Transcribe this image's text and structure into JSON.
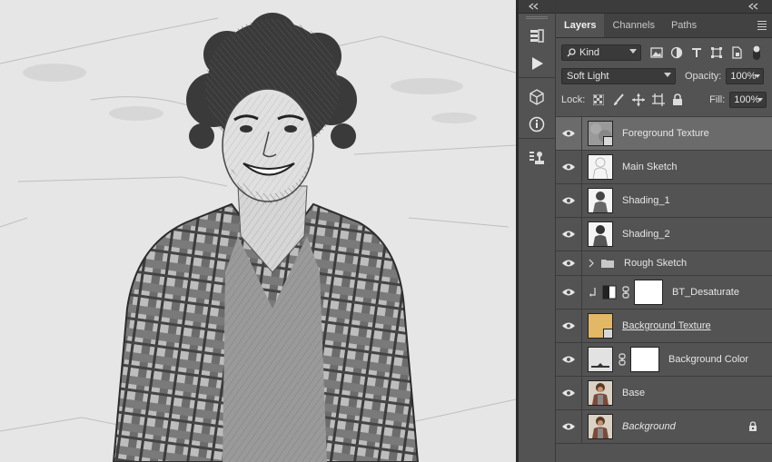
{
  "panel": {
    "tabs": [
      {
        "label": "Layers",
        "active": true
      },
      {
        "label": "Channels",
        "active": false
      },
      {
        "label": "Paths",
        "active": false
      }
    ],
    "filter": {
      "kind_label": "Kind"
    },
    "blend_mode": "Soft Light",
    "opacity_label": "Opacity:",
    "opacity_value": "100%",
    "lock_label": "Lock:",
    "fill_label": "Fill:",
    "fill_value": "100%"
  },
  "layers": [
    {
      "name": "Foreground Texture",
      "selected": true,
      "thumb": "gray-texture",
      "smart": true
    },
    {
      "name": "Main Sketch",
      "thumb": "sketch-light"
    },
    {
      "name": "Shading_1",
      "thumb": "sketch-dark"
    },
    {
      "name": "Shading_2",
      "thumb": "sketch-dark"
    },
    {
      "name": "Rough Sketch",
      "type": "group"
    },
    {
      "name": "BT_Desaturate",
      "type": "adjustment",
      "clipped": true
    },
    {
      "name": "Background Texture",
      "thumb": "tan",
      "color": "#e2b765",
      "smart": true,
      "underline": true
    },
    {
      "name": "Background Color",
      "type": "fill"
    },
    {
      "name": "Base",
      "thumb": "photo"
    },
    {
      "name": "Background",
      "thumb": "photo",
      "italic": true,
      "locked": true
    }
  ],
  "tools": [
    "history-icon",
    "play-icon",
    "cube-icon",
    "info-icon",
    "clone-source-icon"
  ]
}
